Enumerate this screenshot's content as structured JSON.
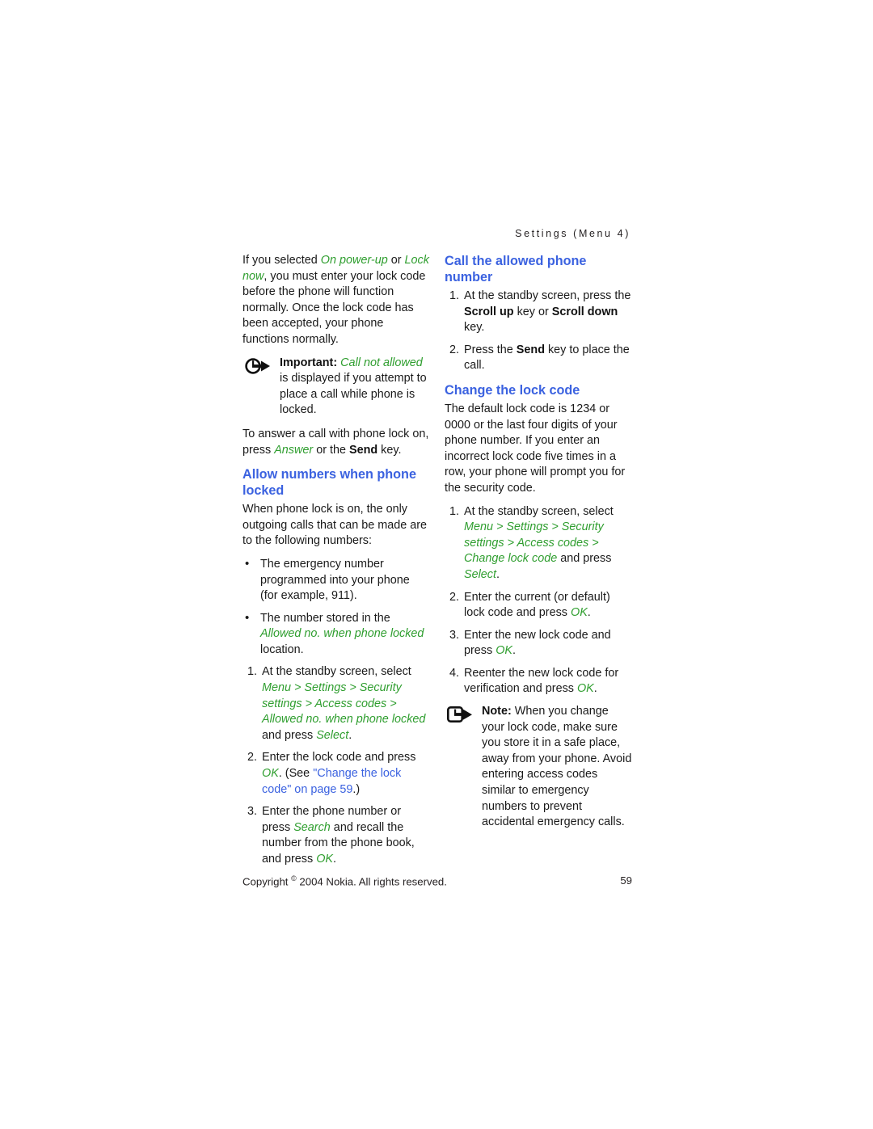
{
  "page": {
    "running_header": "Settings (Menu 4)",
    "page_number": "59",
    "copyright_pre": "Copyright ",
    "copyright_mark": "©",
    "copyright_post": " 2004 Nokia. All rights reserved.",
    "colors": {
      "heading_blue": "#3b62e0",
      "ui_term_green": "#2f9e2f",
      "cross_reference_blue": "#3b62e0",
      "body_text": "#1a1a1a",
      "background": "#ffffff"
    }
  },
  "left_column": {
    "intro_paragraph": {
      "part1": "If you selected ",
      "term1": "On power-up",
      "part2": " or ",
      "term2": "Lock now",
      "part3": ", you must enter your lock code before the phone will function normally. Once the lock code has been accepted, your phone functions normally."
    },
    "important_notice": {
      "icon": "circle-arrow-right-icon",
      "label": "Important:",
      "term": " Call not allowed",
      "text": " is displayed if you attempt to place a call while phone is locked."
    },
    "answer_paragraph": {
      "part1": "To answer a call with phone lock on, press ",
      "term1": "Answer",
      "part2": " or the ",
      "bold1": "Send",
      "part3": " key."
    },
    "heading_allow_numbers": "Allow numbers when phone locked",
    "allow_intro": "When phone lock is on, the only outgoing calls that can be made are to the following numbers:",
    "bullets": [
      {
        "part1": "The emergency number programmed into your phone (for example, 911).",
        "term1": "",
        "part2": ""
      },
      {
        "part1": "The number stored in the ",
        "term1": "Allowed no. when phone locked",
        "part2": " location."
      }
    ],
    "steps": [
      {
        "num": "1.",
        "part1": "At the standby screen, select ",
        "path": "Menu > Settings > Security settings > Access codes > Allowed no. when phone locked",
        "part2": " and press ",
        "term2": "Select",
        "part3": "."
      },
      {
        "num": "2.",
        "part1": "Enter the lock code and press ",
        "term1": "OK",
        "part2": ". (See ",
        "xref": "\"Change the lock code\" on page 59",
        "part3": ".)"
      },
      {
        "num": "3.",
        "part1": "Enter the phone number or press ",
        "term1": "Search",
        "part2": " and recall the number from the phone book, and press ",
        "term2": "OK",
        "part3": "."
      }
    ]
  },
  "right_column": {
    "heading_call_allowed": "Call the allowed phone number",
    "call_steps": [
      {
        "num": "1.",
        "part1": "At the standby screen, press the ",
        "bold1": "Scroll up",
        "part2": " key or ",
        "bold2": "Scroll down",
        "part3": " key."
      },
      {
        "num": "2.",
        "part1": "Press the ",
        "bold1": "Send",
        "part2": " key to place the call.",
        "bold2": "",
        "part3": ""
      }
    ],
    "heading_change_lock": "Change the lock code",
    "change_intro": "The default lock code is 1234 or 0000 or the last four digits of your phone number. If you enter an incorrect lock code five times in a row, your phone will prompt you for the security code.",
    "change_steps": [
      {
        "num": "1.",
        "part1": "At the standby screen, select ",
        "path": "Menu > Settings > Security settings > Access codes > Change lock code",
        "part2": " and press ",
        "term2": "Select",
        "part3": "."
      },
      {
        "num": "2.",
        "part1": "Enter the current (or default) lock code and press ",
        "term1": "OK",
        "part2": ".",
        "term2": "",
        "part3": ""
      },
      {
        "num": "3.",
        "part1": "Enter the new lock code and press ",
        "term1": "OK",
        "part2": ".",
        "term2": "",
        "part3": ""
      },
      {
        "num": "4.",
        "part1": "Reenter the new lock code for verification and press ",
        "term1": "OK",
        "part2": ".",
        "term2": "",
        "part3": ""
      }
    ],
    "note_notice": {
      "icon": "rounded-square-arrow-right-icon",
      "label": "Note:",
      "text": " When you change your lock code, make sure you store it in a safe place, away from your phone. Avoid entering access codes similar to emergency numbers to prevent accidental emergency calls."
    }
  }
}
